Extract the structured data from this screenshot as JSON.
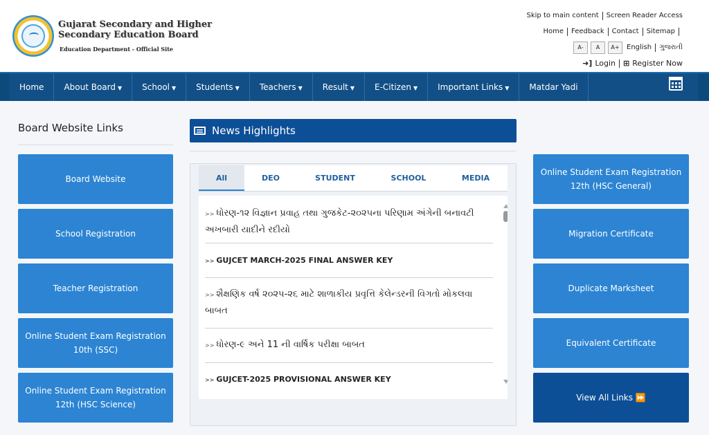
{
  "header": {
    "org_line1": "Gujarat Secondary and Higher",
    "org_line2": "Secondary Education Board",
    "org_sub": "Education Department - Official Site"
  },
  "toplinks": {
    "skip": "Skip to main content",
    "screen_reader": "Screen Reader Access",
    "home": "Home",
    "feedback": "Feedback",
    "contact": "Contact",
    "sitemap": "Sitemap",
    "font_minus": "A-",
    "font_normal": "A",
    "font_plus": "A+",
    "lang_en": "English",
    "lang_gu": "ગુજરાતી",
    "login": "Login",
    "register": "Register Now",
    "login_icon": "sign-in-icon",
    "register_icon": "plus-square-icon"
  },
  "nav": {
    "items": [
      {
        "label": "Home",
        "dropdown": false
      },
      {
        "label": "About Board",
        "dropdown": true
      },
      {
        "label": "School",
        "dropdown": true
      },
      {
        "label": "Students",
        "dropdown": true
      },
      {
        "label": "Teachers",
        "dropdown": true
      },
      {
        "label": "Result",
        "dropdown": true
      },
      {
        "label": "E-Citizen",
        "dropdown": true
      },
      {
        "label": "Important Links",
        "dropdown": true
      },
      {
        "label": "Matdar Yadi",
        "dropdown": false
      }
    ],
    "calendar_icon": "calendar-icon"
  },
  "left": {
    "title": "Board Website Links",
    "buttons": [
      "Board Website",
      "School Registration",
      "Teacher Registration",
      "Online Student Exam Registration 10th (SSC)",
      "Online Student Exam Registration 12th (HSC Science)"
    ]
  },
  "news": {
    "title": "News Highlights",
    "tabs": [
      "All",
      "DEO",
      "STUDENT",
      "SCHOOL",
      "MEDIA"
    ],
    "active_tab": "All",
    "prefix": ">>",
    "items": [
      "ધોરણ-૧૨ વિજ્ઞાન પ્રવાહ તથા ગુજકેટ-૨૦૨૫ના પરિણામ અંગેની બનાવટી અખબારી યાદીને રદીયો",
      "GUJCET MARCH-2025 FINAL ANSWER KEY",
      "શૈક્ષણિક વર્ષ ૨૦૨૫-૨૬ માટે શાળાકીય પ્રવૃત્તિ કેલેન્ડરની વિગતો મોકલવા બાબત",
      "ધોરણ-૯ અને 11 ની વાર્ષિક પરીક્ષા બાબત",
      "GUJCET-2025 PROVISIONAL ANSWER KEY"
    ]
  },
  "right": {
    "buttons": [
      "Online Student Exam Registration 12th (HSC General)",
      "Migration Certificate",
      "Duplicate Marksheet",
      "Equivalent Certificate"
    ],
    "view_all": "View All Links ⏩"
  },
  "colors": {
    "nav_bg": "#124f86",
    "button_blue": "#2c84d3",
    "dark_blue": "#0d4f97"
  }
}
